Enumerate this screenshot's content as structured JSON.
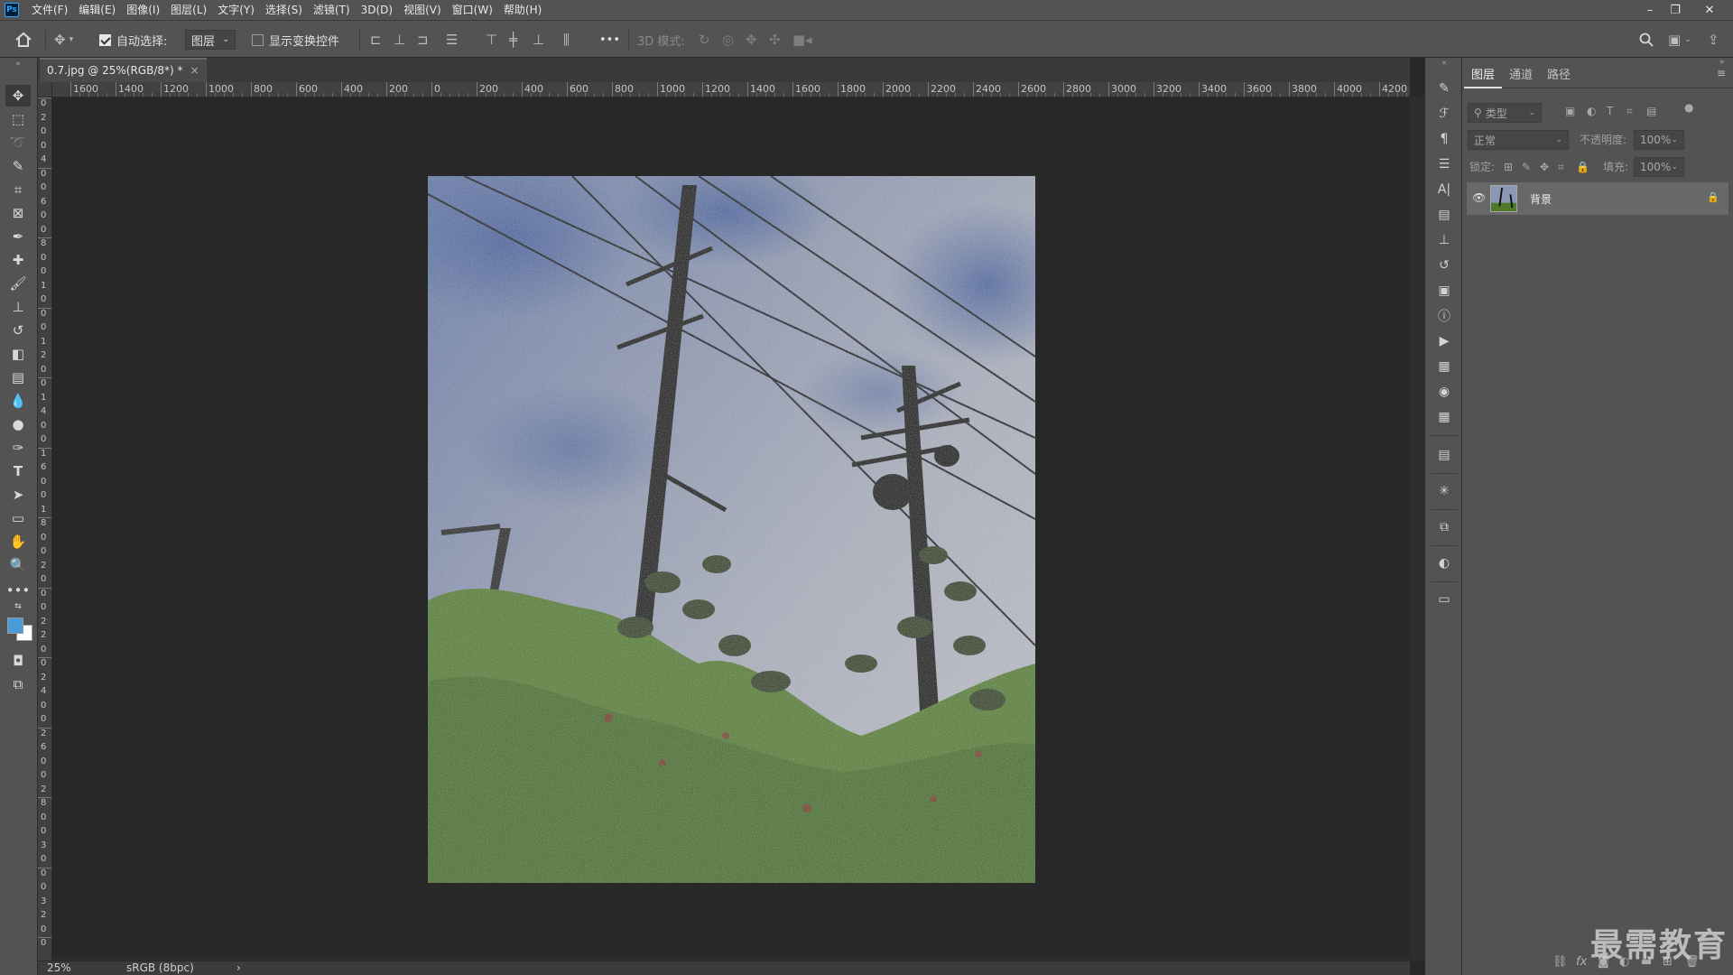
{
  "app": {
    "logo": "Ps"
  },
  "menu": [
    "文件(F)",
    "编辑(E)",
    "图像(I)",
    "图层(L)",
    "文字(Y)",
    "选择(S)",
    "滤镜(T)",
    "3D(D)",
    "视图(V)",
    "窗口(W)",
    "帮助(H)"
  ],
  "options": {
    "auto_select_label": "自动选择:",
    "auto_select_checked": true,
    "auto_select_target": "图层",
    "show_transform_label": "显示变换控件",
    "show_transform_checked": false,
    "more_label": "•••",
    "mode_3d_label": "3D 模式:"
  },
  "document": {
    "tab_title": "0.7.jpg @ 25%(RGB/8*) *",
    "close_glyph": "×"
  },
  "ruler": {
    "top_labels": [
      "1600",
      "1400",
      "1200",
      "1000",
      "800",
      "600",
      "400",
      "200",
      "0",
      "200",
      "400",
      "600",
      "800",
      "1000",
      "1200",
      "1400",
      "1600",
      "1800",
      "2000",
      "2200",
      "2400",
      "2600",
      "2800",
      "3000",
      "3200",
      "3400",
      "3600",
      "3800",
      "4000",
      "4200"
    ],
    "left_labels": [
      "0",
      "2",
      "0",
      "0",
      "4",
      "0",
      "0",
      "6",
      "0",
      "0",
      "8",
      "0",
      "0",
      "1",
      "0",
      "0",
      "0",
      "1",
      "2",
      "0",
      "0",
      "1",
      "4",
      "0",
      "0",
      "1",
      "6",
      "0",
      "0",
      "1",
      "8",
      "0",
      "0",
      "2",
      "0",
      "0",
      "0",
      "2",
      "2",
      "0",
      "0",
      "2",
      "4",
      "0",
      "0",
      "2",
      "6",
      "0",
      "0",
      "2",
      "8",
      "0",
      "0",
      "3",
      "0",
      "0",
      "0",
      "3",
      "2",
      "0",
      "0"
    ]
  },
  "status": {
    "zoom": "25%",
    "color_profile": "sRGB (8bpc)",
    "arrow": "›"
  },
  "layers_panel": {
    "tabs": [
      "图层",
      "通道",
      "路径"
    ],
    "active_tab": 0,
    "filter_placeholder": "类型",
    "blend_mode": "正常",
    "opacity_label": "不透明度:",
    "opacity_value": "100%",
    "lock_label": "锁定:",
    "fill_label": "填充:",
    "fill_value": "100%",
    "layers": [
      {
        "name": "背景",
        "visible": true,
        "locked": true
      }
    ]
  },
  "watermark": "最需教育",
  "colors": {
    "foreground": "#4a9bd8",
    "background": "#ffffff",
    "accent": "#31a8ff"
  }
}
